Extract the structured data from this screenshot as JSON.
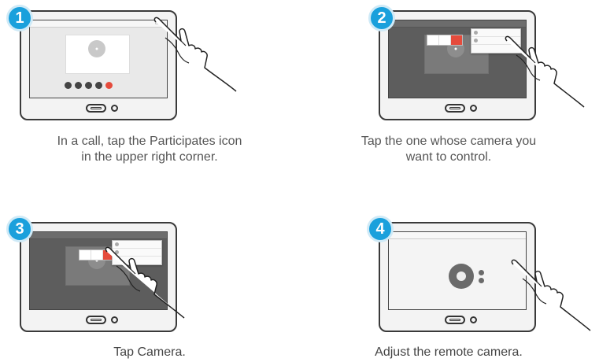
{
  "steps": [
    {
      "number": "1",
      "caption_line1": "In a call, tap the Participates icon",
      "caption_line2": "in the upper right corner."
    },
    {
      "number": "2",
      "caption_line1": "Tap the one whose camera you",
      "caption_line2": "want to control."
    },
    {
      "number": "3",
      "caption_line1": "Tap Camera.",
      "caption_line2": ""
    },
    {
      "number": "4",
      "caption_line1": "Adjust the remote camera.",
      "caption_line2": ""
    }
  ],
  "colors": {
    "badge": "#1aa0dc",
    "end_call": "#e54b3c"
  },
  "icons": [
    "hand-pointer-icon",
    "participants-icon",
    "camera-joystick-icon"
  ]
}
